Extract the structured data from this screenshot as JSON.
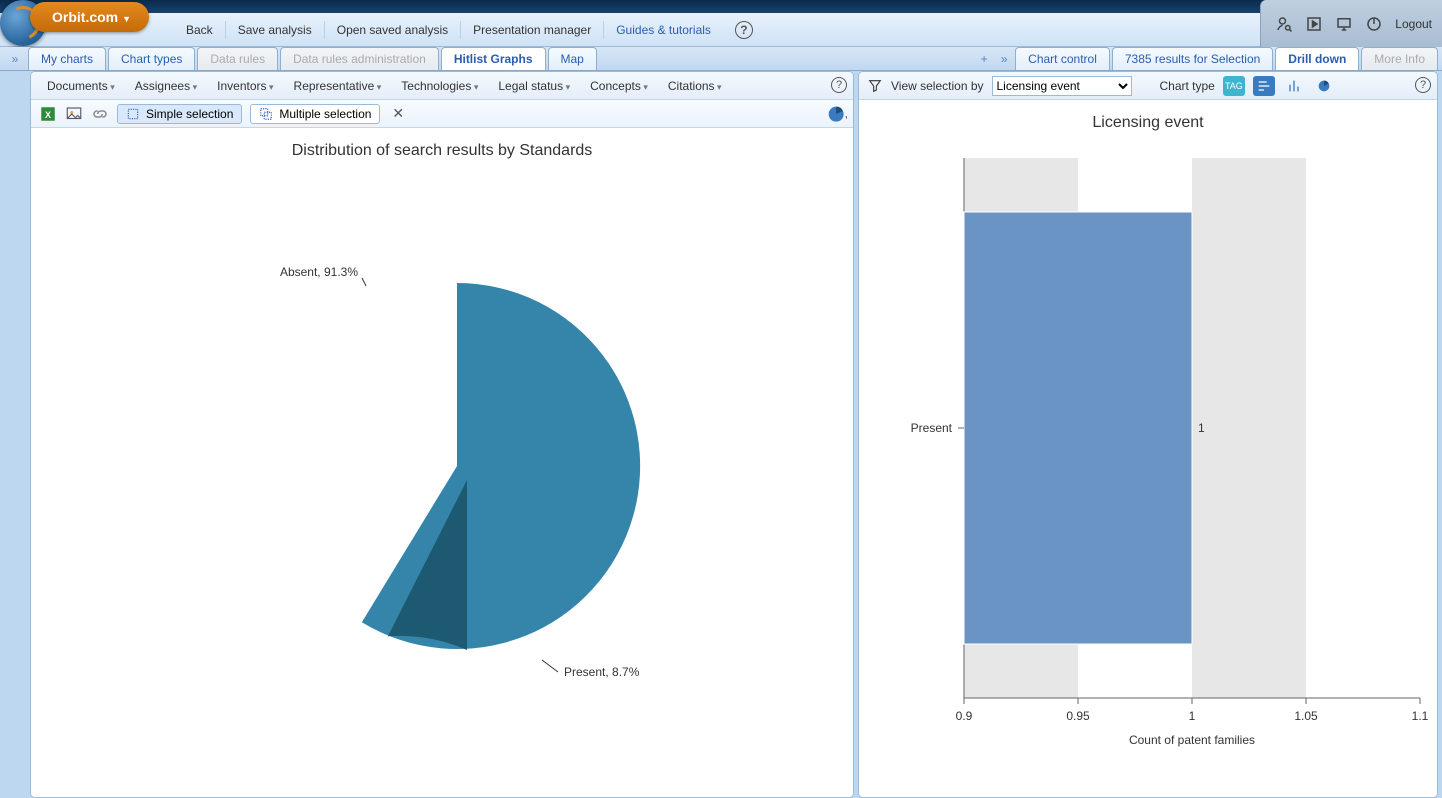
{
  "brand": "Orbit.com",
  "top_menu": {
    "back": "Back",
    "save_analysis": "Save analysis",
    "open_saved": "Open saved analysis",
    "presentation": "Presentation manager",
    "guides": "Guides & tutorials"
  },
  "header_right": {
    "logout": "Logout"
  },
  "tabs_left": {
    "my_charts": "My charts",
    "chart_types": "Chart types",
    "data_rules": "Data rules",
    "data_rules_admin": "Data rules administration",
    "hitlist": "Hitlist Graphs",
    "map": "Map"
  },
  "tabs_right": {
    "chart_control": "Chart control",
    "results": "7385 results for Selection",
    "drill_down": "Drill down",
    "more_info": "More Info"
  },
  "filterbar": {
    "documents": "Documents",
    "assignees": "Assignees",
    "inventors": "Inventors",
    "representative": "Representative",
    "technologies": "Technologies",
    "legal_status": "Legal status",
    "concepts": "Concepts",
    "citations": "Citations"
  },
  "toolbar": {
    "simple": "Simple selection",
    "multiple": "Multiple selection"
  },
  "right_bar": {
    "view_by": "View selection by",
    "dropdown": "Licensing event",
    "chart_type": "Chart type"
  },
  "pie": {
    "title": "Distribution of search results by Standards",
    "absent_label": "Absent, 91.3%",
    "present_label": "Present, 8.7%"
  },
  "bar": {
    "title": "Licensing event",
    "ycat": "Present",
    "value_label": "1",
    "xlabel": "Count of patent families",
    "ticks": {
      "t0": "0.9",
      "t1": "0.95",
      "t2": "1",
      "t3": "1.05",
      "t4": "1.1"
    }
  },
  "chart_data": [
    {
      "type": "pie",
      "title": "Distribution of search results by Standards",
      "series": [
        {
          "name": "Absent",
          "value": 91.3
        },
        {
          "name": "Present",
          "value": 8.7
        }
      ]
    },
    {
      "type": "bar",
      "orientation": "horizontal",
      "title": "Licensing event",
      "categories": [
        "Present"
      ],
      "values": [
        1
      ],
      "xlabel": "Count of patent families",
      "ylabel": "",
      "xlim": [
        0.9,
        1.1
      ]
    }
  ]
}
